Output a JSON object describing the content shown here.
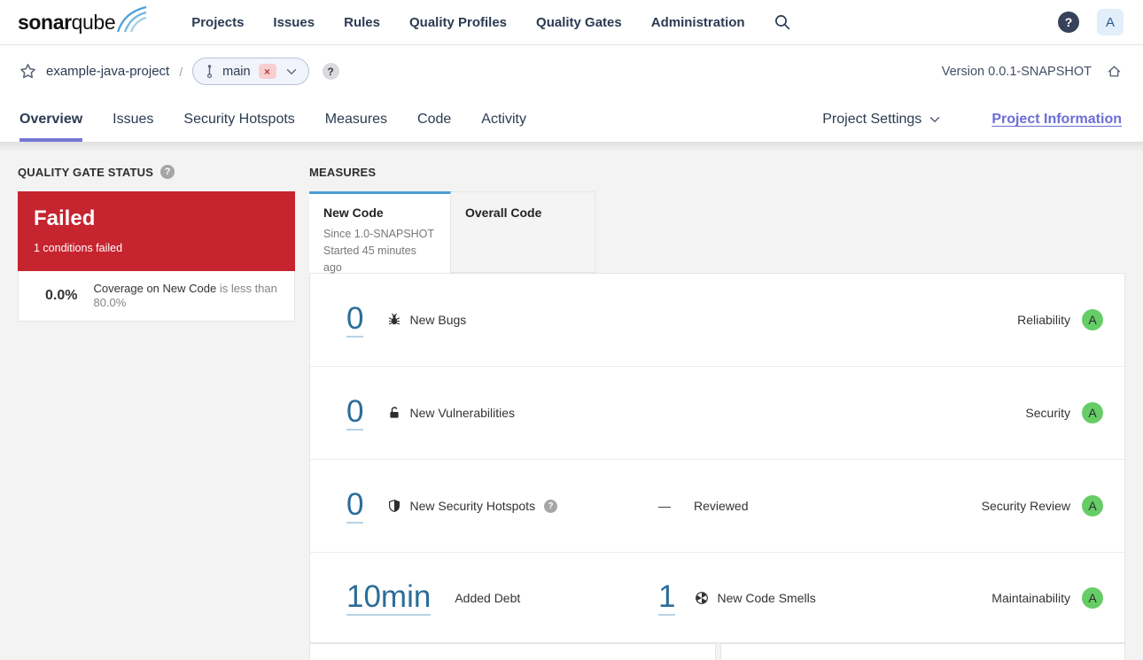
{
  "nav": {
    "brand_bold": "sonar",
    "brand_light": "qube",
    "items": [
      "Projects",
      "Issues",
      "Rules",
      "Quality Profiles",
      "Quality Gates",
      "Administration"
    ],
    "help_glyph": "?",
    "avatar": "A"
  },
  "breadcrumb": {
    "project": "example-java-project",
    "separator": "/",
    "branch": "main",
    "remove_glyph": "×",
    "help_glyph": "?",
    "version": "Version 0.0.1-SNAPSHOT"
  },
  "tabs": {
    "items": [
      "Overview",
      "Issues",
      "Security Hotspots",
      "Measures",
      "Code",
      "Activity"
    ],
    "active": "Overview",
    "project_settings": "Project Settings",
    "project_information": "Project Information"
  },
  "quality_gate": {
    "heading": "QUALITY GATE STATUS",
    "help_glyph": "?",
    "status": "Failed",
    "conditions_text": "1 conditions failed",
    "condition_value": "0.0%",
    "condition_metric": "Coverage on New Code",
    "condition_detail": "is less than 80.0%"
  },
  "measures": {
    "heading": "MEASURES",
    "new_code_tab": {
      "label": "New Code",
      "since": "Since 1.0-SNAPSHOT",
      "started": "Started 45 minutes ago"
    },
    "overall_tab": {
      "label": "Overall Code"
    },
    "rows": [
      {
        "value": "0",
        "label": "New Bugs",
        "category": "Reliability",
        "rating": "A"
      },
      {
        "value": "0",
        "label": "New Vulnerabilities",
        "category": "Security",
        "rating": "A"
      },
      {
        "value": "0",
        "label": "New Security Hotspots",
        "help_glyph": "?",
        "dash": "—",
        "reviewed_label": "Reviewed",
        "category": "Security Review",
        "rating": "A"
      },
      {
        "value": "10min",
        "label": "Added Debt",
        "value2": "1",
        "label2": "New Code Smells",
        "category": "Maintainability",
        "rating": "A"
      }
    ]
  },
  "colors": {
    "failed_red": "#c6242f",
    "rating_a_green": "#66cd66",
    "number_link_blue": "#2a6d99",
    "new_code_tab_accent": "#4b9fd5",
    "accent_purple": "#7678d4"
  }
}
